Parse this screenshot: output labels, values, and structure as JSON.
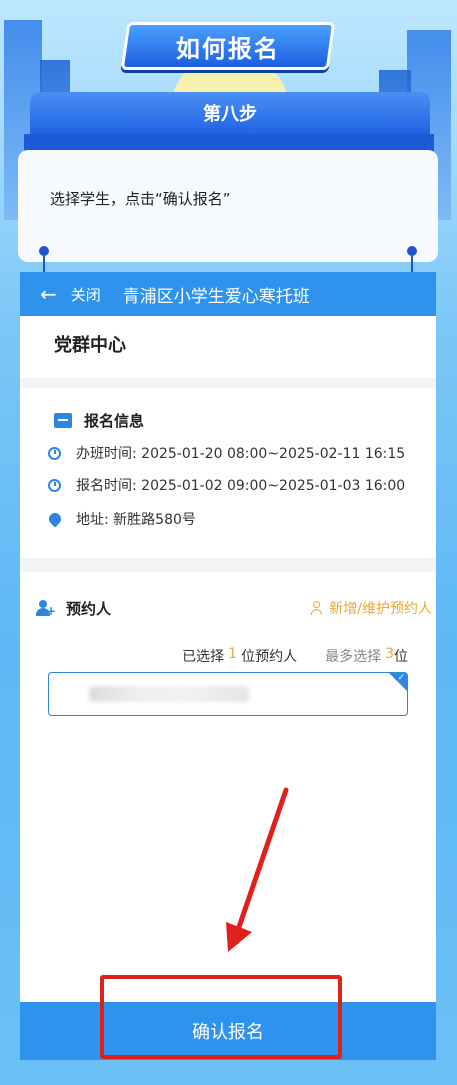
{
  "page": {
    "title": "如何报名",
    "step": "第八步",
    "instruction": "选择学生，点击“确认报名”"
  },
  "app": {
    "back_icon": "arrow-left-icon",
    "close_label": "关闭",
    "title": "青浦区小学生爱心寒托班",
    "org_name": "党群中心",
    "section_title": "报名信息",
    "info": [
      {
        "icon": "clock-icon",
        "text": "办班时间: 2025-01-20 08:00~2025-02-11 16:15"
      },
      {
        "icon": "clock-icon",
        "text": "报名时间: 2025-01-02 09:00~2025-01-03 16:00"
      },
      {
        "icon": "location-pin-icon",
        "text": "地址: 新胜路580号"
      }
    ],
    "reservation": {
      "label": "预约人",
      "add_label": "新增/维护预约人",
      "selected_prefix": "已选择",
      "selected_count": "1",
      "selected_suffix": "位预约人",
      "max_prefix": "最多选择",
      "max_count": "3",
      "max_suffix": "位"
    },
    "confirm_label": "确认报名"
  },
  "colors": {
    "primary": "#2f93ee",
    "accent": "#e8a93a",
    "highlight": "#e0201d"
  }
}
